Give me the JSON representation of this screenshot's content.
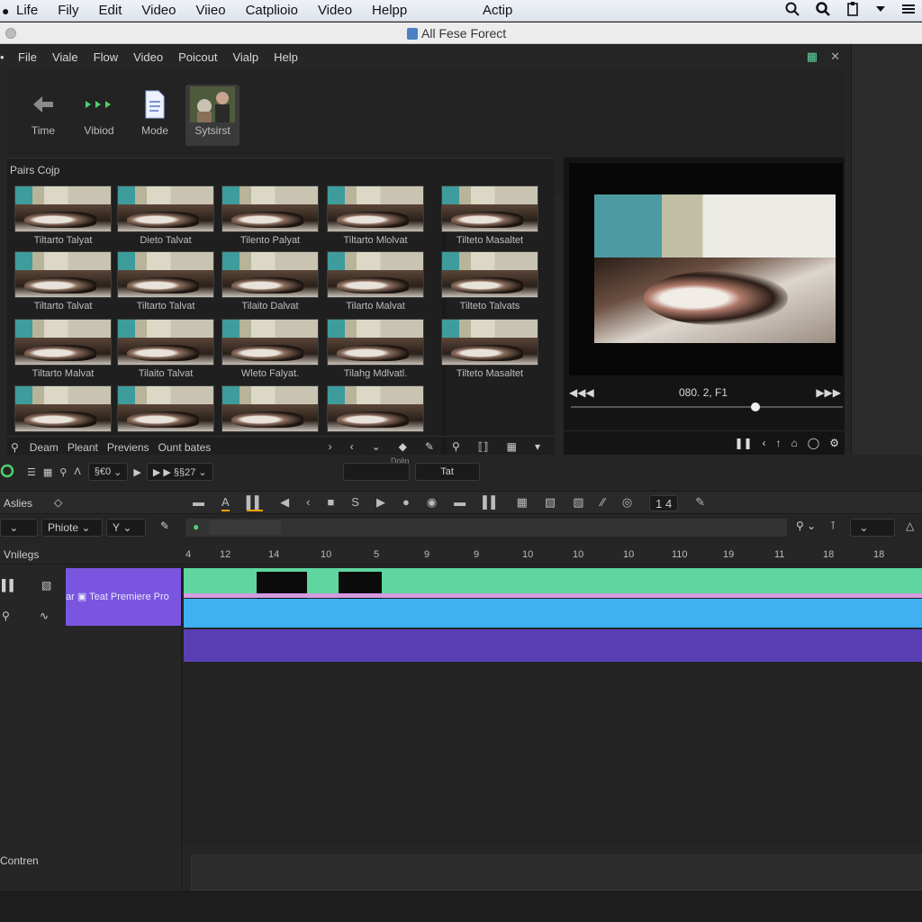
{
  "menubar": {
    "items": [
      "Life",
      "Fily",
      "Edit",
      "Video",
      "Viieo",
      "Catplioio",
      "Video",
      "Helpp"
    ],
    "center": "Actip"
  },
  "window": {
    "title": "All Fese Forect"
  },
  "app_menu": {
    "items": [
      "File",
      "Viale",
      "Flow",
      "Video",
      "Poicout",
      "Vialp",
      "Help"
    ]
  },
  "tools": [
    {
      "label": "Time",
      "icon": "arrow-pointer-icon"
    },
    {
      "label": "Vibiod",
      "icon": "green-arrows-icon"
    },
    {
      "label": "Mode",
      "icon": "document-icon"
    },
    {
      "label": "Sytsirst",
      "icon": "portrait-thumbnail-icon"
    }
  ],
  "library": {
    "header": "Pairs Cojp",
    "captions": [
      [
        "Tiltarto Talyat",
        "Dieto Talvat",
        "Tilento Palyat",
        "Tiltarto Mlolvat",
        "Tilteto Masaltet"
      ],
      [
        "Tiltarto Talvat",
        "Tiltarto Talvat",
        "Tilaito Dalvat",
        "Tilarto Malvat",
        "Tilteto Talvats"
      ],
      [
        "Tiltarto Malvat",
        "Tilaito Talvat",
        "Wleto Falyat.",
        "Tilahg Mdlvatl.",
        "Tilteto Masaltet"
      ],
      [
        "",
        "",
        "",
        ""
      ]
    ],
    "bottom_labels": [
      "Deam",
      "Pleant",
      "Previens",
      "Ount bates"
    ]
  },
  "viewer": {
    "timecode": "080. 2, F1",
    "progress": 0.68
  },
  "timeline": {
    "top_label": "Dolin",
    "pill1": "§€0",
    "pill2": "▶ ▶ §§27",
    "pill3": "Tat",
    "ctl_label": "Aslies",
    "row_pill": "Phiote",
    "row_pill2": "Y",
    "ruler_label": "Vnilegs",
    "ticks": [
      "4",
      "12",
      "14",
      "10",
      "5",
      "9",
      "9",
      "10",
      "10",
      "10",
      "110",
      "19",
      "11",
      "18"
    ],
    "clip_name": "ar ▣ Teat Premiere Pro",
    "footer_label": "Contren",
    "zoom": "1 4"
  }
}
